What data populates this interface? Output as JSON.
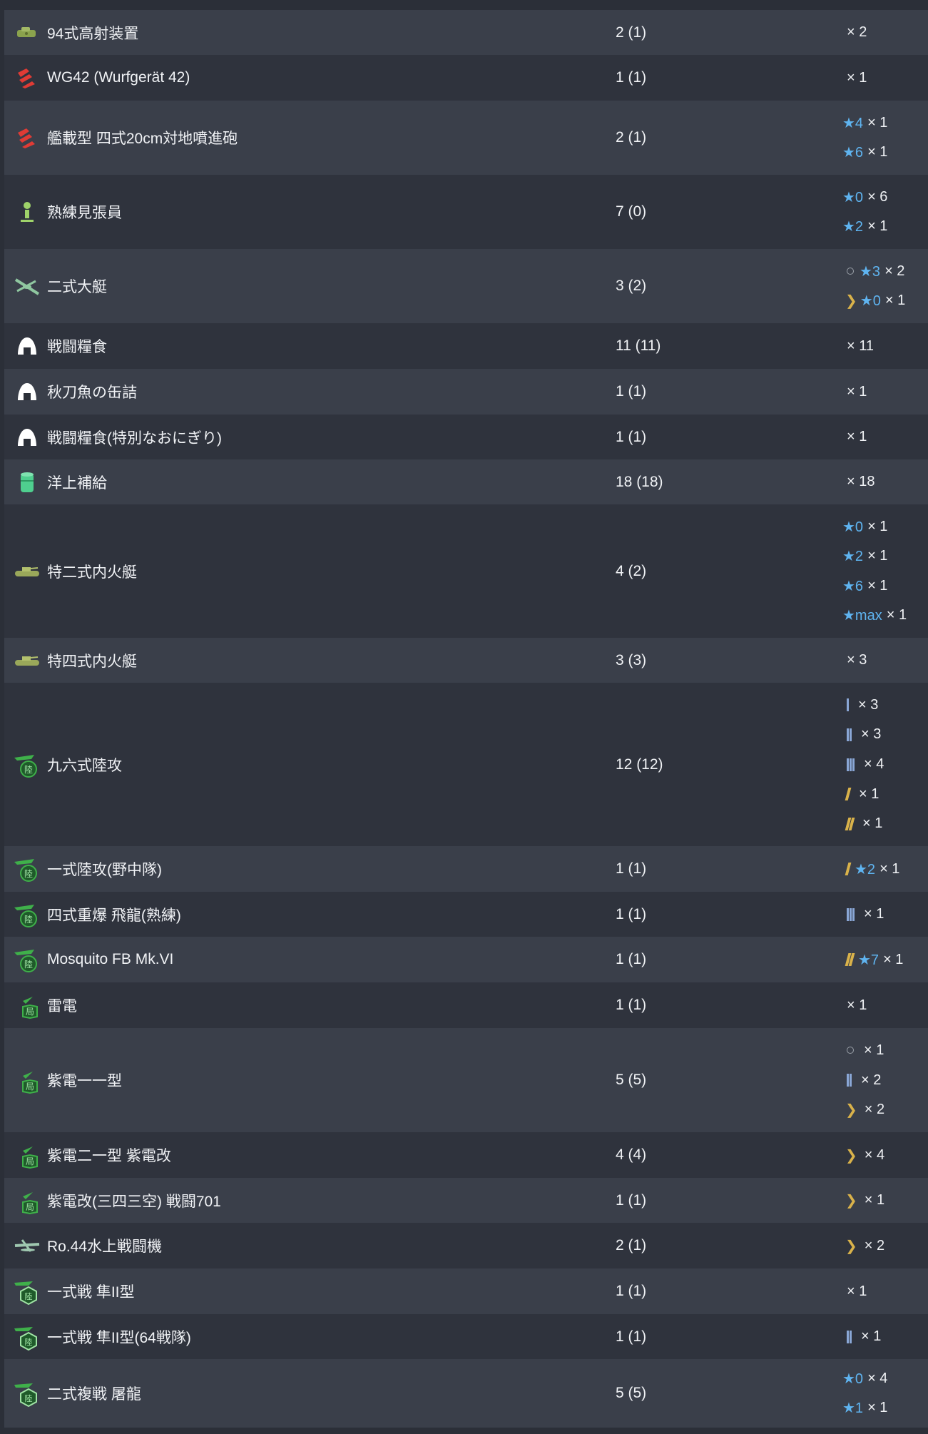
{
  "rows": [
    {
      "name": "94式高射装置",
      "count": "2 (1)",
      "icon": "aa-fire-director-icon",
      "details": [
        {
          "kind": "plain",
          "times": "× 2"
        }
      ]
    },
    {
      "name": "WG42 (Wurfgerät 42)",
      "count": "1 (1)",
      "icon": "rocket-launcher-icon",
      "details": [
        {
          "kind": "plain",
          "times": "× 1"
        }
      ]
    },
    {
      "name": "艦載型 四式20cm対地噴進砲",
      "count": "2 (1)",
      "icon": "rocket-launcher-icon",
      "details": [
        {
          "kind": "star",
          "star": "★4",
          "times": "× 1"
        },
        {
          "kind": "star",
          "star": "★6",
          "times": "× 1"
        }
      ]
    },
    {
      "name": "熟練見張員",
      "count": "7 (0)",
      "icon": "lookout-icon",
      "details": [
        {
          "kind": "star",
          "star": "★0",
          "times": "× 6"
        },
        {
          "kind": "star",
          "star": "★2",
          "times": "× 1"
        }
      ]
    },
    {
      "name": "二式大艇",
      "count": "3 (2)",
      "icon": "flying-boat-icon",
      "details": [
        {
          "kind": "ringstar",
          "star": "★3",
          "times": "× 2"
        },
        {
          "kind": "chevstar",
          "star": "★0",
          "times": "× 1"
        }
      ]
    },
    {
      "name": "戦闘糧食",
      "count": "11 (11)",
      "icon": "ration-icon",
      "details": [
        {
          "kind": "plain",
          "times": "× 11"
        }
      ]
    },
    {
      "name": "秋刀魚の缶詰",
      "count": "1 (1)",
      "icon": "ration-icon",
      "details": [
        {
          "kind": "plain",
          "times": "× 1"
        }
      ]
    },
    {
      "name": "戦闘糧食(特別なおにぎり)",
      "count": "1 (1)",
      "icon": "ration-icon",
      "details": [
        {
          "kind": "plain",
          "times": "× 1"
        }
      ]
    },
    {
      "name": "洋上補給",
      "count": "18 (18)",
      "icon": "drum-icon",
      "details": [
        {
          "kind": "plain",
          "times": "× 18"
        }
      ]
    },
    {
      "name": "特二式内火艇",
      "count": "4 (2)",
      "icon": "amphibious-tank-icon",
      "details": [
        {
          "kind": "star",
          "star": "★0",
          "times": "× 1"
        },
        {
          "kind": "star",
          "star": "★2",
          "times": "× 1"
        },
        {
          "kind": "star",
          "star": "★6",
          "times": "× 1"
        },
        {
          "kind": "star",
          "star": "★max",
          "times": "× 1"
        }
      ]
    },
    {
      "name": "特四式内火艇",
      "count": "3 (3)",
      "icon": "amphibious-tank-icon",
      "details": [
        {
          "kind": "plain",
          "times": "× 3"
        }
      ]
    },
    {
      "name": "九六式陸攻",
      "count": "12 (12)",
      "icon": "land-attacker-icon",
      "details": [
        {
          "kind": "bar1",
          "times": "× 3"
        },
        {
          "kind": "bar2",
          "times": "× 3"
        },
        {
          "kind": "bar3",
          "times": "× 4"
        },
        {
          "kind": "gold1",
          "times": "× 1"
        },
        {
          "kind": "gold2",
          "times": "× 1"
        }
      ]
    },
    {
      "name": "一式陸攻(野中隊)",
      "count": "1 (1)",
      "icon": "land-attacker-icon",
      "details": [
        {
          "kind": "gold1star",
          "star": "★2",
          "times": "× 1"
        }
      ]
    },
    {
      "name": "四式重爆 飛龍(熟練)",
      "count": "1 (1)",
      "icon": "land-attacker-icon",
      "details": [
        {
          "kind": "bar3",
          "times": "× 1"
        }
      ]
    },
    {
      "name": "Mosquito FB Mk.VI",
      "count": "1 (1)",
      "icon": "land-attacker-icon",
      "details": [
        {
          "kind": "gold2star",
          "star": "★7",
          "times": "× 1"
        }
      ]
    },
    {
      "name": "雷電",
      "count": "1 (1)",
      "icon": "interceptor-icon",
      "details": [
        {
          "kind": "plain",
          "times": "× 1"
        }
      ]
    },
    {
      "name": "紫電一一型",
      "count": "5 (5)",
      "icon": "interceptor-icon",
      "details": [
        {
          "kind": "ring",
          "times": "× 1"
        },
        {
          "kind": "bar2",
          "times": "× 2"
        },
        {
          "kind": "chev",
          "times": "× 2"
        }
      ]
    },
    {
      "name": "紫電二一型 紫電改",
      "count": "4 (4)",
      "icon": "interceptor-icon",
      "details": [
        {
          "kind": "chev",
          "times": "× 4"
        }
      ]
    },
    {
      "name": "紫電改(三四三空) 戦闘701",
      "count": "1 (1)",
      "icon": "interceptor-icon",
      "details": [
        {
          "kind": "chev",
          "times": "× 1"
        }
      ]
    },
    {
      "name": "Ro.44水上戦闘機",
      "count": "2 (1)",
      "icon": "seaplane-fighter-icon",
      "details": [
        {
          "kind": "chev",
          "times": "× 2"
        }
      ]
    },
    {
      "name": "一式戦 隼II型",
      "count": "1 (1)",
      "icon": "army-fighter-icon",
      "details": [
        {
          "kind": "plain",
          "times": "× 1"
        }
      ]
    },
    {
      "name": "一式戦 隼II型(64戦隊)",
      "count": "1 (1)",
      "icon": "army-fighter-icon",
      "details": [
        {
          "kind": "bar2",
          "times": "× 1"
        }
      ]
    },
    {
      "name": "二式複戦 屠龍",
      "count": "5 (5)",
      "icon": "army-fighter-icon",
      "details": [
        {
          "kind": "star",
          "star": "★0",
          "times": "× 4"
        },
        {
          "kind": "star",
          "star": "★1",
          "times": "× 1"
        }
      ]
    }
  ],
  "colors": {
    "odd_row": "#3a3f4a",
    "even_row": "#2f333d",
    "star": "#5fb4f0",
    "gold": "#d9b24a",
    "blue_bar": "#8aa7d6"
  }
}
